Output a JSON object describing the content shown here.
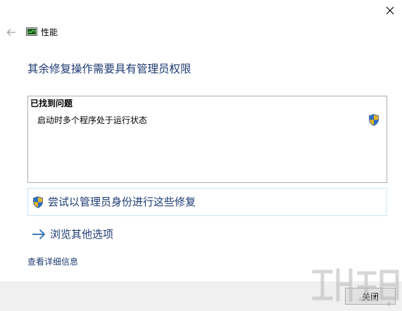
{
  "window": {
    "close_glyph": "✕"
  },
  "nav": {
    "back_icon": "back-arrow-icon",
    "app_icon": "performance-monitor-icon",
    "title": "性能"
  },
  "main": {
    "heading": "其余修复操作需要具有管理员权限",
    "problems": {
      "header": "已找到问题",
      "items": [
        {
          "label": "启动时多个程序处于运行状态",
          "icon": "uac-shield-icon"
        }
      ]
    },
    "admin_action": {
      "label": "尝试以管理员身份进行这些修复",
      "icon": "uac-shield-icon"
    },
    "browse_action": {
      "label": "浏览其他选项",
      "icon": "right-arrow-icon"
    },
    "details_link": "查看详细信息"
  },
  "footer": {
    "close_label": "关闭"
  },
  "colors": {
    "link_blue": "#1f3b73",
    "arrow_blue": "#2b6cb0",
    "shield_blue": "#2f6fc1",
    "shield_gold": "#e6b422",
    "footer_bg": "#f0f0f0"
  }
}
